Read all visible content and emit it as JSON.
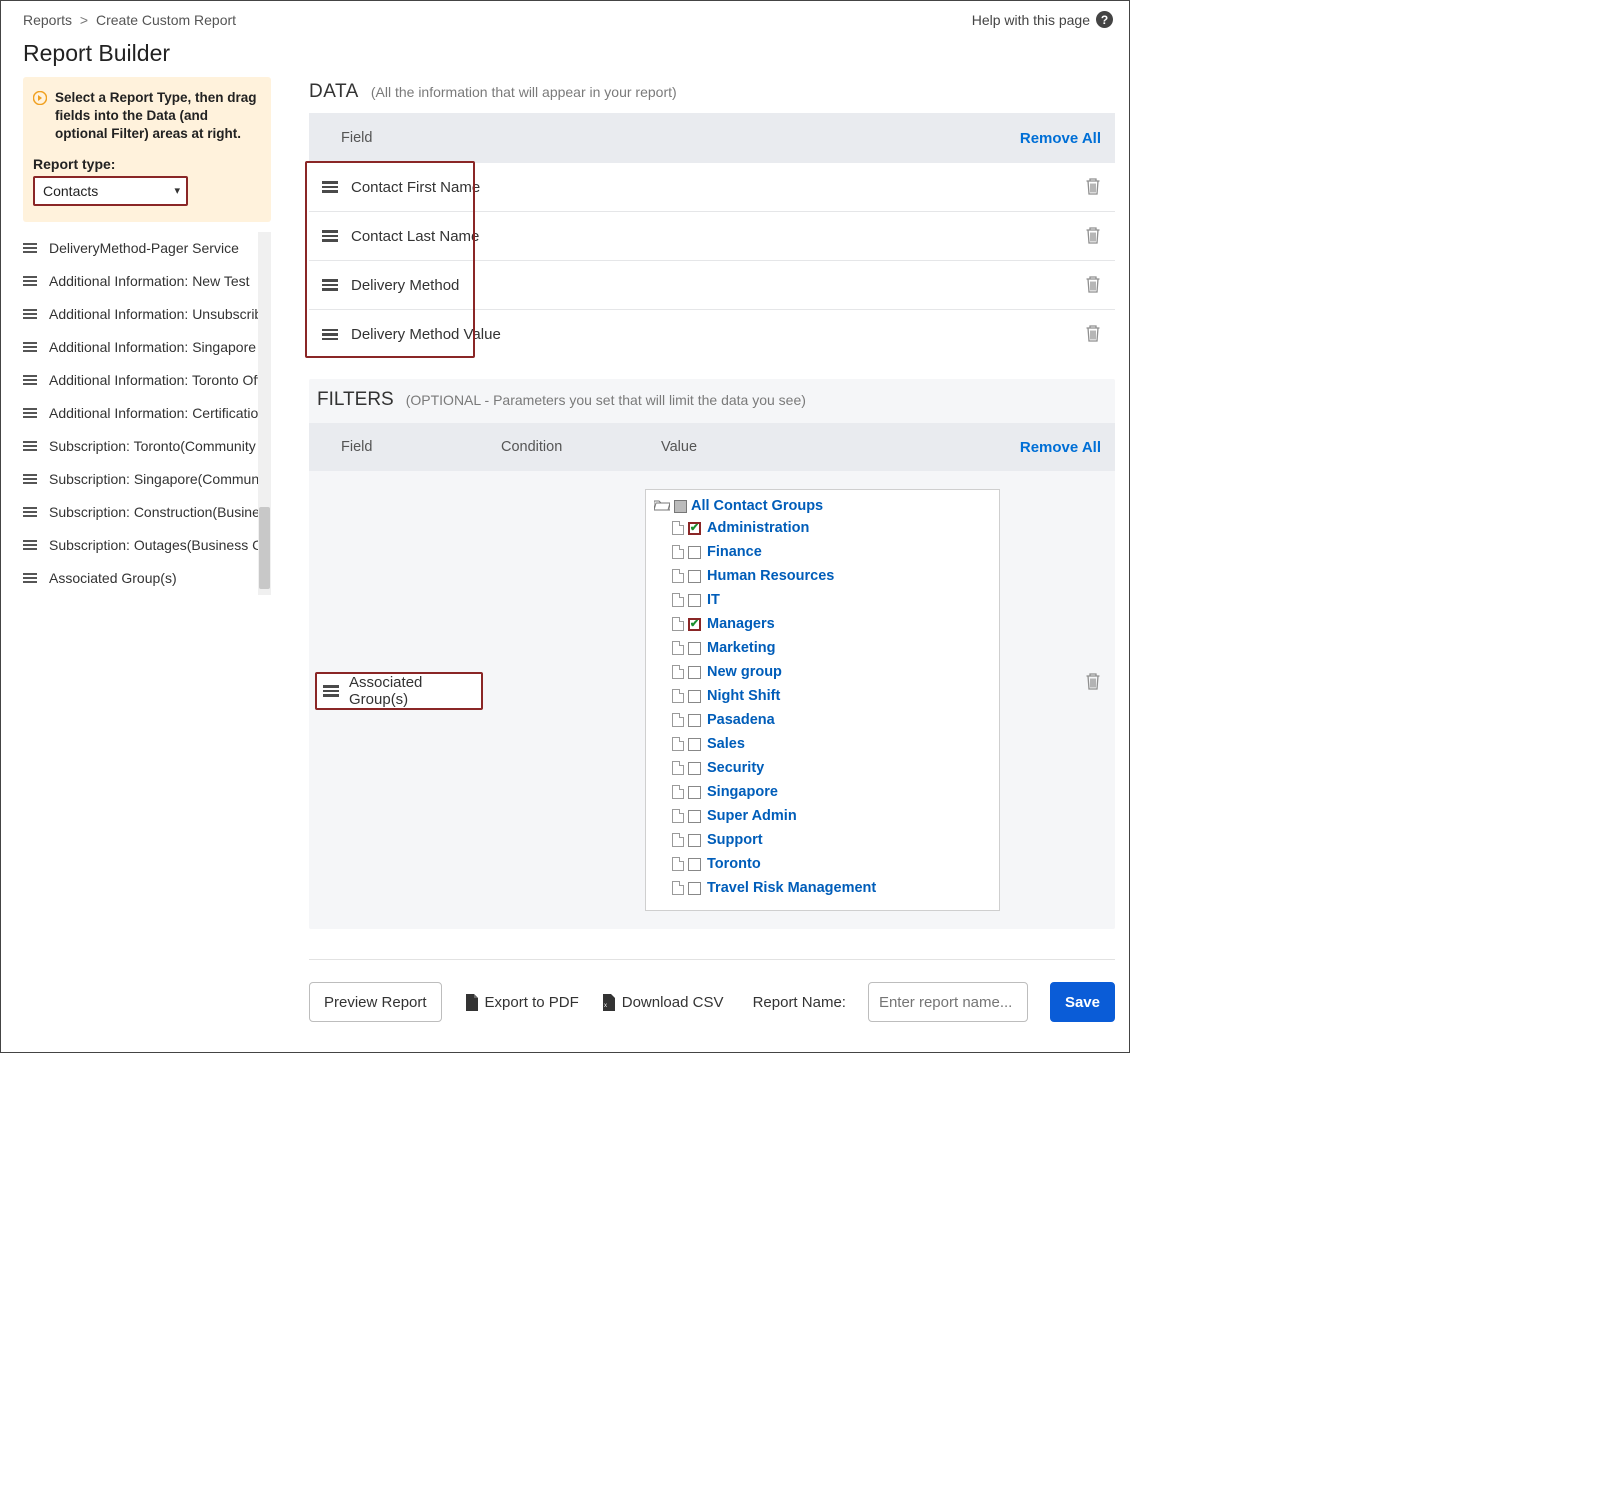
{
  "breadcrumb": {
    "root": "Reports",
    "current": "Create Custom Report"
  },
  "help_label": "Help with this page",
  "page_title": "Report Builder",
  "hint_text": "Select a Report Type, then drag fields into the Data (and optional Filter) areas at right.",
  "report_type": {
    "label": "Report type:",
    "value": "Contacts"
  },
  "available_fields": [
    "DeliveryMethod-Pager Service",
    "Additional Information: New Test",
    "Additional Information: Unsubscribe…",
    "Additional Information: Singapore O…",
    "Additional Information: Toronto Offic…",
    "Additional Information: Certifications",
    "Subscription: Toronto(Community O…",
    "Subscription: Singapore(Community …",
    "Subscription: Construction(Business…",
    "Subscription: Outages(Business Con…",
    "Associated Group(s)"
  ],
  "data_section": {
    "title": "DATA",
    "hint": "(All the information that will appear in your report)",
    "header_field": "Field",
    "remove_all": "Remove All",
    "rows": [
      "Contact First Name",
      "Contact Last Name",
      "Delivery Method",
      "Delivery Method Value"
    ]
  },
  "filters_section": {
    "title": "FILTERS",
    "hint": "(OPTIONAL - Parameters you set that will limit the data you see)",
    "header_field": "Field",
    "header_condition": "Condition",
    "header_value": "Value",
    "remove_all": "Remove All",
    "filter_field_label": "Associated Group(s)",
    "tree_root": "All Contact Groups",
    "tree_items": [
      {
        "label": "Administration",
        "checked": true
      },
      {
        "label": "Finance",
        "checked": false
      },
      {
        "label": "Human Resources",
        "checked": false
      },
      {
        "label": "IT",
        "checked": false
      },
      {
        "label": "Managers",
        "checked": true
      },
      {
        "label": "Marketing",
        "checked": false
      },
      {
        "label": "New group",
        "checked": false
      },
      {
        "label": "Night Shift",
        "checked": false
      },
      {
        "label": "Pasadena",
        "checked": false
      },
      {
        "label": "Sales",
        "checked": false
      },
      {
        "label": "Security",
        "checked": false
      },
      {
        "label": "Singapore",
        "checked": false
      },
      {
        "label": "Super Admin",
        "checked": false
      },
      {
        "label": "Support",
        "checked": false
      },
      {
        "label": "Toronto",
        "checked": false
      },
      {
        "label": "Travel Risk Management",
        "checked": false
      }
    ]
  },
  "bottom": {
    "preview": "Preview Report",
    "export_pdf": "Export to PDF",
    "download_csv": "Download CSV",
    "report_name_label": "Report Name:",
    "report_name_placeholder": "Enter report name...",
    "save": "Save"
  }
}
